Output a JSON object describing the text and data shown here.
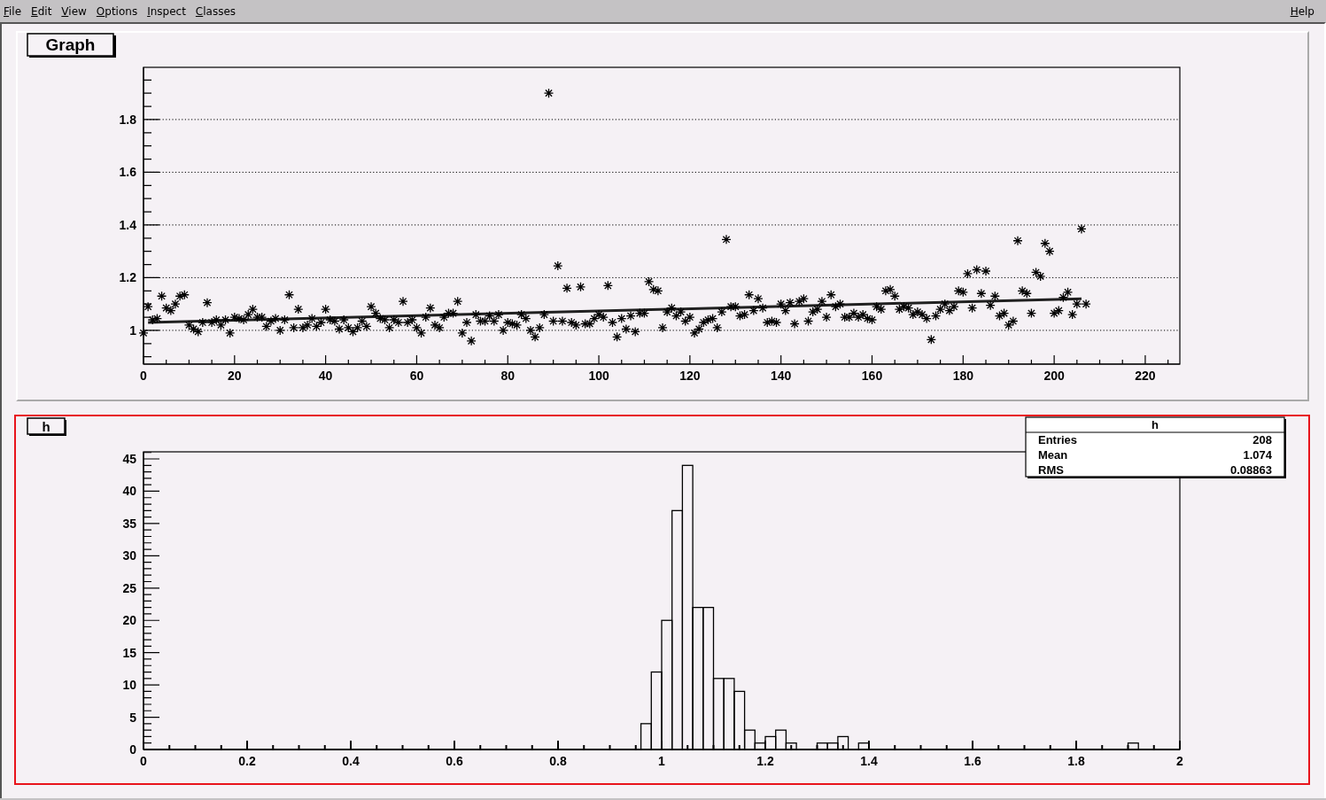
{
  "menu": {
    "items": [
      {
        "label": "File"
      },
      {
        "label": "Edit"
      },
      {
        "label": "View"
      },
      {
        "label": "Options"
      },
      {
        "label": "Inspect"
      },
      {
        "label": "Classes"
      }
    ],
    "help": "Help"
  },
  "pads": [
    {
      "selected": false,
      "chart_data": {
        "type": "scatter",
        "title": "Graph",
        "grid": true,
        "xlim": [
          0,
          227.6
        ],
        "ylim": [
          0.872,
          1.998
        ],
        "xticks": [
          0,
          20,
          40,
          60,
          80,
          100,
          120,
          140,
          160,
          180,
          200,
          220
        ],
        "yticks": [
          1,
          1.2,
          1.4,
          1.6,
          1.8
        ],
        "x": [
          0,
          1,
          2,
          3,
          4,
          5,
          6,
          7,
          8,
          9,
          10,
          11,
          12,
          13,
          14,
          15,
          16,
          17,
          18,
          19,
          20,
          21,
          22,
          23,
          24,
          25,
          26,
          27,
          28,
          29,
          30,
          31,
          32,
          33,
          34,
          35,
          36,
          37,
          38,
          39,
          40,
          41,
          42,
          43,
          44,
          45,
          46,
          47,
          48,
          49,
          50,
          51,
          52,
          53,
          54,
          55,
          56,
          57,
          58,
          59,
          60,
          61,
          62,
          63,
          64,
          65,
          66,
          67,
          68,
          69,
          70,
          71,
          72,
          73,
          74,
          75,
          76,
          77,
          78,
          79,
          80,
          81,
          82,
          83,
          84,
          85,
          86,
          87,
          88,
          89,
          90,
          91,
          92,
          93,
          94,
          95,
          96,
          97,
          98,
          99,
          100,
          101,
          102,
          103,
          104,
          105,
          106,
          107,
          108,
          109,
          110,
          111,
          112,
          113,
          114,
          115,
          116,
          117,
          118,
          119,
          120,
          121,
          122,
          123,
          124,
          125,
          126,
          127,
          128,
          129,
          130,
          131,
          132,
          133,
          134,
          135,
          136,
          137,
          138,
          139,
          140,
          141,
          142,
          143,
          144,
          145,
          146,
          147,
          148,
          149,
          150,
          151,
          152,
          153,
          154,
          155,
          156,
          157,
          158,
          159,
          160,
          161,
          162,
          163,
          164,
          165,
          166,
          167,
          168,
          169,
          170,
          171,
          172,
          173,
          174,
          175,
          176,
          177,
          178,
          179,
          180,
          181,
          182,
          183,
          184,
          185,
          186,
          187,
          188,
          189,
          190,
          191,
          192,
          193,
          194,
          195,
          196,
          197,
          198,
          199,
          200,
          201,
          202,
          203,
          204,
          205,
          206,
          207
        ],
        "series": [
          {
            "color": "#000000",
            "values": [
              0.99,
              1.09,
              1.04,
              1.045,
              1.13,
              1.085,
              1.075,
              1.1,
              1.13,
              1.135,
              1.02,
              1.005,
              0.995,
              1.03,
              1.105,
              1.03,
              1.04,
              1.02,
              1.04,
              0.99,
              1.05,
              1.045,
              1.04,
              1.06,
              1.08,
              1.05,
              1.05,
              1.015,
              1.035,
              1.045,
              1.0,
              1.04,
              1.135,
              1.01,
              1.08,
              1.01,
              1.02,
              1.045,
              1.015,
              1.03,
              1.08,
              1.04,
              1.035,
              1.005,
              1.04,
              1.01,
              0.995,
              1.01,
              1.035,
              1.015,
              1.09,
              1.065,
              1.045,
              1.04,
              1.01,
              1.04,
              1.03,
              1.11,
              1.03,
              1.04,
              1.01,
              0.99,
              1.05,
              1.085,
              1.02,
              1.01,
              1.05,
              1.065,
              1.065,
              1.11,
              0.99,
              1.03,
              0.96,
              1.06,
              1.035,
              1.035,
              1.055,
              1.035,
              1.06,
              1.0,
              1.03,
              1.025,
              1.02,
              1.06,
              1.045,
              1.0,
              0.975,
              1.01,
              1.06,
              1.9,
              1.035,
              1.245,
              1.035,
              1.16,
              1.03,
              1.02,
              1.165,
              1.025,
              1.025,
              1.045,
              1.06,
              1.05,
              1.17,
              1.03,
              0.975,
              1.045,
              1.005,
              1.055,
              0.995,
              1.065,
              1.065,
              1.185,
              1.155,
              1.15,
              1.01,
              1.07,
              1.085,
              1.055,
              1.07,
              1.035,
              1.05,
              0.99,
              1.005,
              1.03,
              1.04,
              1.045,
              1.01,
              1.07,
              1.345,
              1.09,
              1.09,
              1.055,
              1.06,
              1.135,
              1.075,
              1.12,
              1.085,
              1.03,
              1.035,
              1.03,
              1.1,
              1.075,
              1.105,
              1.025,
              1.11,
              1.12,
              1.035,
              1.07,
              1.08,
              1.11,
              1.05,
              1.135,
              1.09,
              1.1,
              1.05,
              1.05,
              1.065,
              1.05,
              1.06,
              1.045,
              1.04,
              1.09,
              1.08,
              1.15,
              1.155,
              1.13,
              1.08,
              1.09,
              1.085,
              1.06,
              1.07,
              1.06,
              1.045,
              0.965,
              1.055,
              1.08,
              1.1,
              1.075,
              1.09,
              1.15,
              1.145,
              1.215,
              1.085,
              1.23,
              1.14,
              1.225,
              1.095,
              1.13,
              1.055,
              1.065,
              1.02,
              1.035,
              1.34,
              1.15,
              1.14,
              1.065,
              1.22,
              1.205,
              1.33,
              1.3,
              1.065,
              1.075,
              1.125,
              1.145,
              1.06,
              1.1,
              1.385,
              1.1
            ]
          },
          {
            "type": "line",
            "color": "#202020",
            "x": [
              1,
              206
            ],
            "values": [
              1.03,
              1.12
            ]
          }
        ]
      }
    },
    {
      "selected": true,
      "chart_data": {
        "type": "bar",
        "title": "h",
        "xlim": [
          0,
          2
        ],
        "ylim": [
          0,
          46.1
        ],
        "xticks": [
          0,
          0.2,
          0.4,
          0.6,
          0.8,
          1,
          1.2,
          1.4,
          1.6,
          1.8,
          2
        ],
        "yticks": [
          0,
          5,
          10,
          15,
          20,
          25,
          30,
          35,
          40,
          45
        ],
        "x": [
          0.01,
          0.03,
          0.05,
          0.07,
          0.09,
          0.11,
          0.13,
          0.15,
          0.17,
          0.19,
          0.21,
          0.23,
          0.25,
          0.27,
          0.29,
          0.31,
          0.33,
          0.35,
          0.37,
          0.39,
          0.41,
          0.43,
          0.45,
          0.47,
          0.49,
          0.51,
          0.53,
          0.55,
          0.57,
          0.59,
          0.61,
          0.63,
          0.65,
          0.67,
          0.69,
          0.71,
          0.73,
          0.75,
          0.77,
          0.79,
          0.81,
          0.83,
          0.85,
          0.87,
          0.89,
          0.91,
          0.93,
          0.95,
          0.97,
          0.99,
          1.01,
          1.03,
          1.05,
          1.07,
          1.09,
          1.11,
          1.13,
          1.15,
          1.17,
          1.19,
          1.21,
          1.23,
          1.25,
          1.27,
          1.29,
          1.31,
          1.33,
          1.35,
          1.37,
          1.39,
          1.41,
          1.43,
          1.45,
          1.47,
          1.49,
          1.51,
          1.53,
          1.55,
          1.57,
          1.59,
          1.61,
          1.63,
          1.65,
          1.67,
          1.69,
          1.71,
          1.73,
          1.75,
          1.77,
          1.79,
          1.81,
          1.83,
          1.85,
          1.87,
          1.89,
          1.91,
          1.93,
          1.95,
          1.97,
          1.99
        ],
        "series": [
          {
            "values": [
              0,
              0,
              0,
              0,
              0,
              0,
              0,
              0,
              0,
              0,
              0,
              0,
              0,
              0,
              0,
              0,
              0,
              0,
              0,
              0,
              0,
              0,
              0,
              0,
              0,
              0,
              0,
              0,
              0,
              0,
              0,
              0,
              0,
              0,
              0,
              0,
              0,
              0,
              0,
              0,
              0,
              0,
              0,
              0,
              0,
              0,
              0,
              0,
              4,
              12,
              20,
              37,
              44,
              22,
              22,
              11,
              11,
              9,
              3,
              1,
              2,
              3,
              1,
              0,
              0,
              1,
              1,
              2,
              0,
              1,
              0,
              0,
              0,
              0,
              0,
              0,
              0,
              0,
              0,
              0,
              0,
              0,
              0,
              0,
              0,
              0,
              0,
              0,
              0,
              0,
              0,
              0,
              0,
              0,
              0,
              1,
              0,
              0,
              0,
              0
            ]
          }
        ]
      },
      "stats": {
        "title": "h",
        "rows": [
          {
            "label": "Entries",
            "value": "208"
          },
          {
            "label": "Mean",
            "value": "1.074"
          },
          {
            "label": "RMS",
            "value": "0.08863"
          }
        ]
      }
    }
  ]
}
